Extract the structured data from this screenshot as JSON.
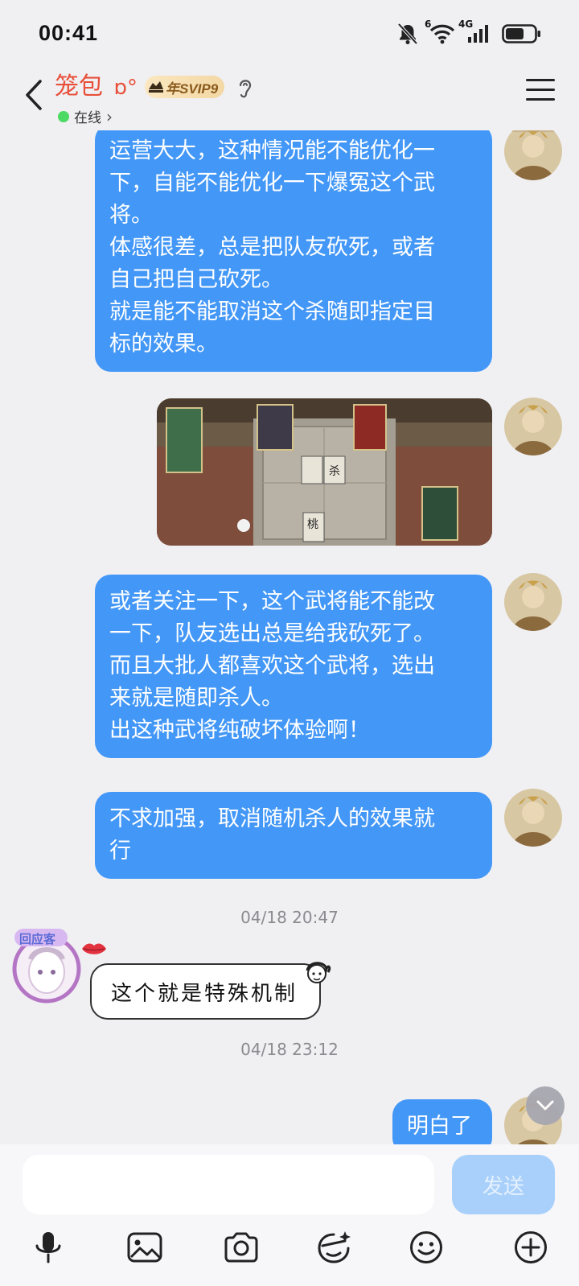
{
  "status_bar": {
    "time": "00:41",
    "wifi_label": "6",
    "network_label": "4G"
  },
  "header": {
    "contact_name": "笼包",
    "name_suffix": "ɒ°",
    "vip_badge": "年SVIP9",
    "online_status": "在线",
    "online_arrow": "›"
  },
  "messages": [
    {
      "id": 1,
      "sender": "me",
      "type": "text",
      "text": "运营大大，这种情况能不能优化一\n下，自能不能优化一下爆冤这个武\n将。\n体感很差，总是把队友砍死，或者\n自己把自己砍死。\n就是能不能取消这个杀随即指定目\n标的效果。"
    },
    {
      "id": 2,
      "sender": "me",
      "type": "image",
      "image_label": "游戏截图",
      "card_texts": [
        "桃",
        "杀"
      ]
    },
    {
      "id": 3,
      "sender": "me",
      "type": "text",
      "text": "或者关注一下，这个武将能不能改\n一下，队友选出总是给我砍死了。\n而且大批人都喜欢这个武将，选出\n来就是随即杀人。\n出这种武将纯破坏体验啊！"
    },
    {
      "id": 4,
      "sender": "me",
      "type": "text",
      "text": "不求加强，取消随机杀人的效果就\n行"
    },
    {
      "id": 5,
      "type": "timestamp",
      "text": "04/18 20:47"
    },
    {
      "id": 6,
      "sender": "other",
      "type": "sticker",
      "text": "这个就是特殊机制",
      "avatar_tag": "回应客"
    },
    {
      "id": 7,
      "type": "timestamp",
      "text": "04/18 23:12"
    },
    {
      "id": 8,
      "sender": "me",
      "type": "text",
      "text": "明白了"
    }
  ],
  "input": {
    "value": "",
    "placeholder": "",
    "send_label": "发送"
  },
  "toolbar": [
    "microphone-icon",
    "image-icon",
    "camera-icon",
    "sticker-face-icon",
    "emoji-icon",
    "plus-icon"
  ],
  "colors": {
    "bubble_me": "#4397f7",
    "name": "#e8503a",
    "online": "#4cd964",
    "send_disabled": "#a9d0fb"
  }
}
